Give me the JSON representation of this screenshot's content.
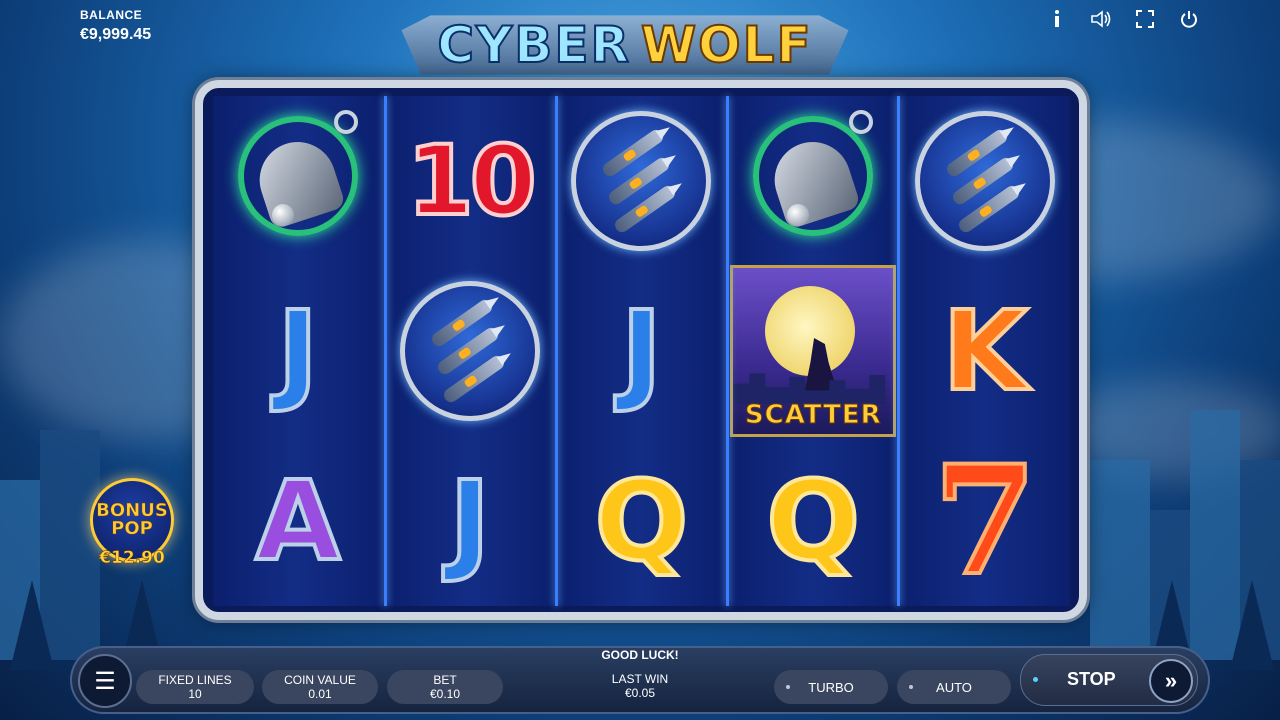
{
  "balance": {
    "label": "BALANCE",
    "value": "€9,999.45"
  },
  "logo": {
    "part1": "CYBER",
    "part2": "WOLF"
  },
  "top_icons": [
    "info-icon",
    "sound-icon",
    "fullscreen-icon",
    "power-icon"
  ],
  "reels": [
    [
      "bell",
      "J",
      "A"
    ],
    [
      "10",
      "claw",
      "J"
    ],
    [
      "claw",
      "J",
      "Q"
    ],
    [
      "bell",
      "scatter",
      "Q"
    ],
    [
      "claw",
      "K",
      "7"
    ]
  ],
  "symbols": {
    "ten": "10",
    "J": "J",
    "A": "A",
    "Q": "Q",
    "K": "K",
    "seven": "7",
    "scatter_label": "SCATTER"
  },
  "bonus": {
    "line1": "BONUS",
    "line2": "POP",
    "amount": "€12.90"
  },
  "bottom_bar": {
    "message": "GOOD LUCK!",
    "fixed_lines": {
      "label": "FIXED LINES",
      "value": "10"
    },
    "coin_value": {
      "label": "COIN VALUE",
      "value": "0.01"
    },
    "bet": {
      "label": "BET",
      "value": "€0.10"
    },
    "last_win": {
      "label": "LAST WIN",
      "value": "€0.05"
    },
    "turbo": "TURBO",
    "auto": "AUTO",
    "stop": "STOP"
  },
  "colors": {
    "letter_blue": "#2a7fe8",
    "letter_purple": "#9a4ee0",
    "letter_gold": "#ffc61a",
    "letter_orange": "#ff7a1a",
    "ten_red": "#e3172b",
    "accent_gold": "#ffcb35"
  }
}
